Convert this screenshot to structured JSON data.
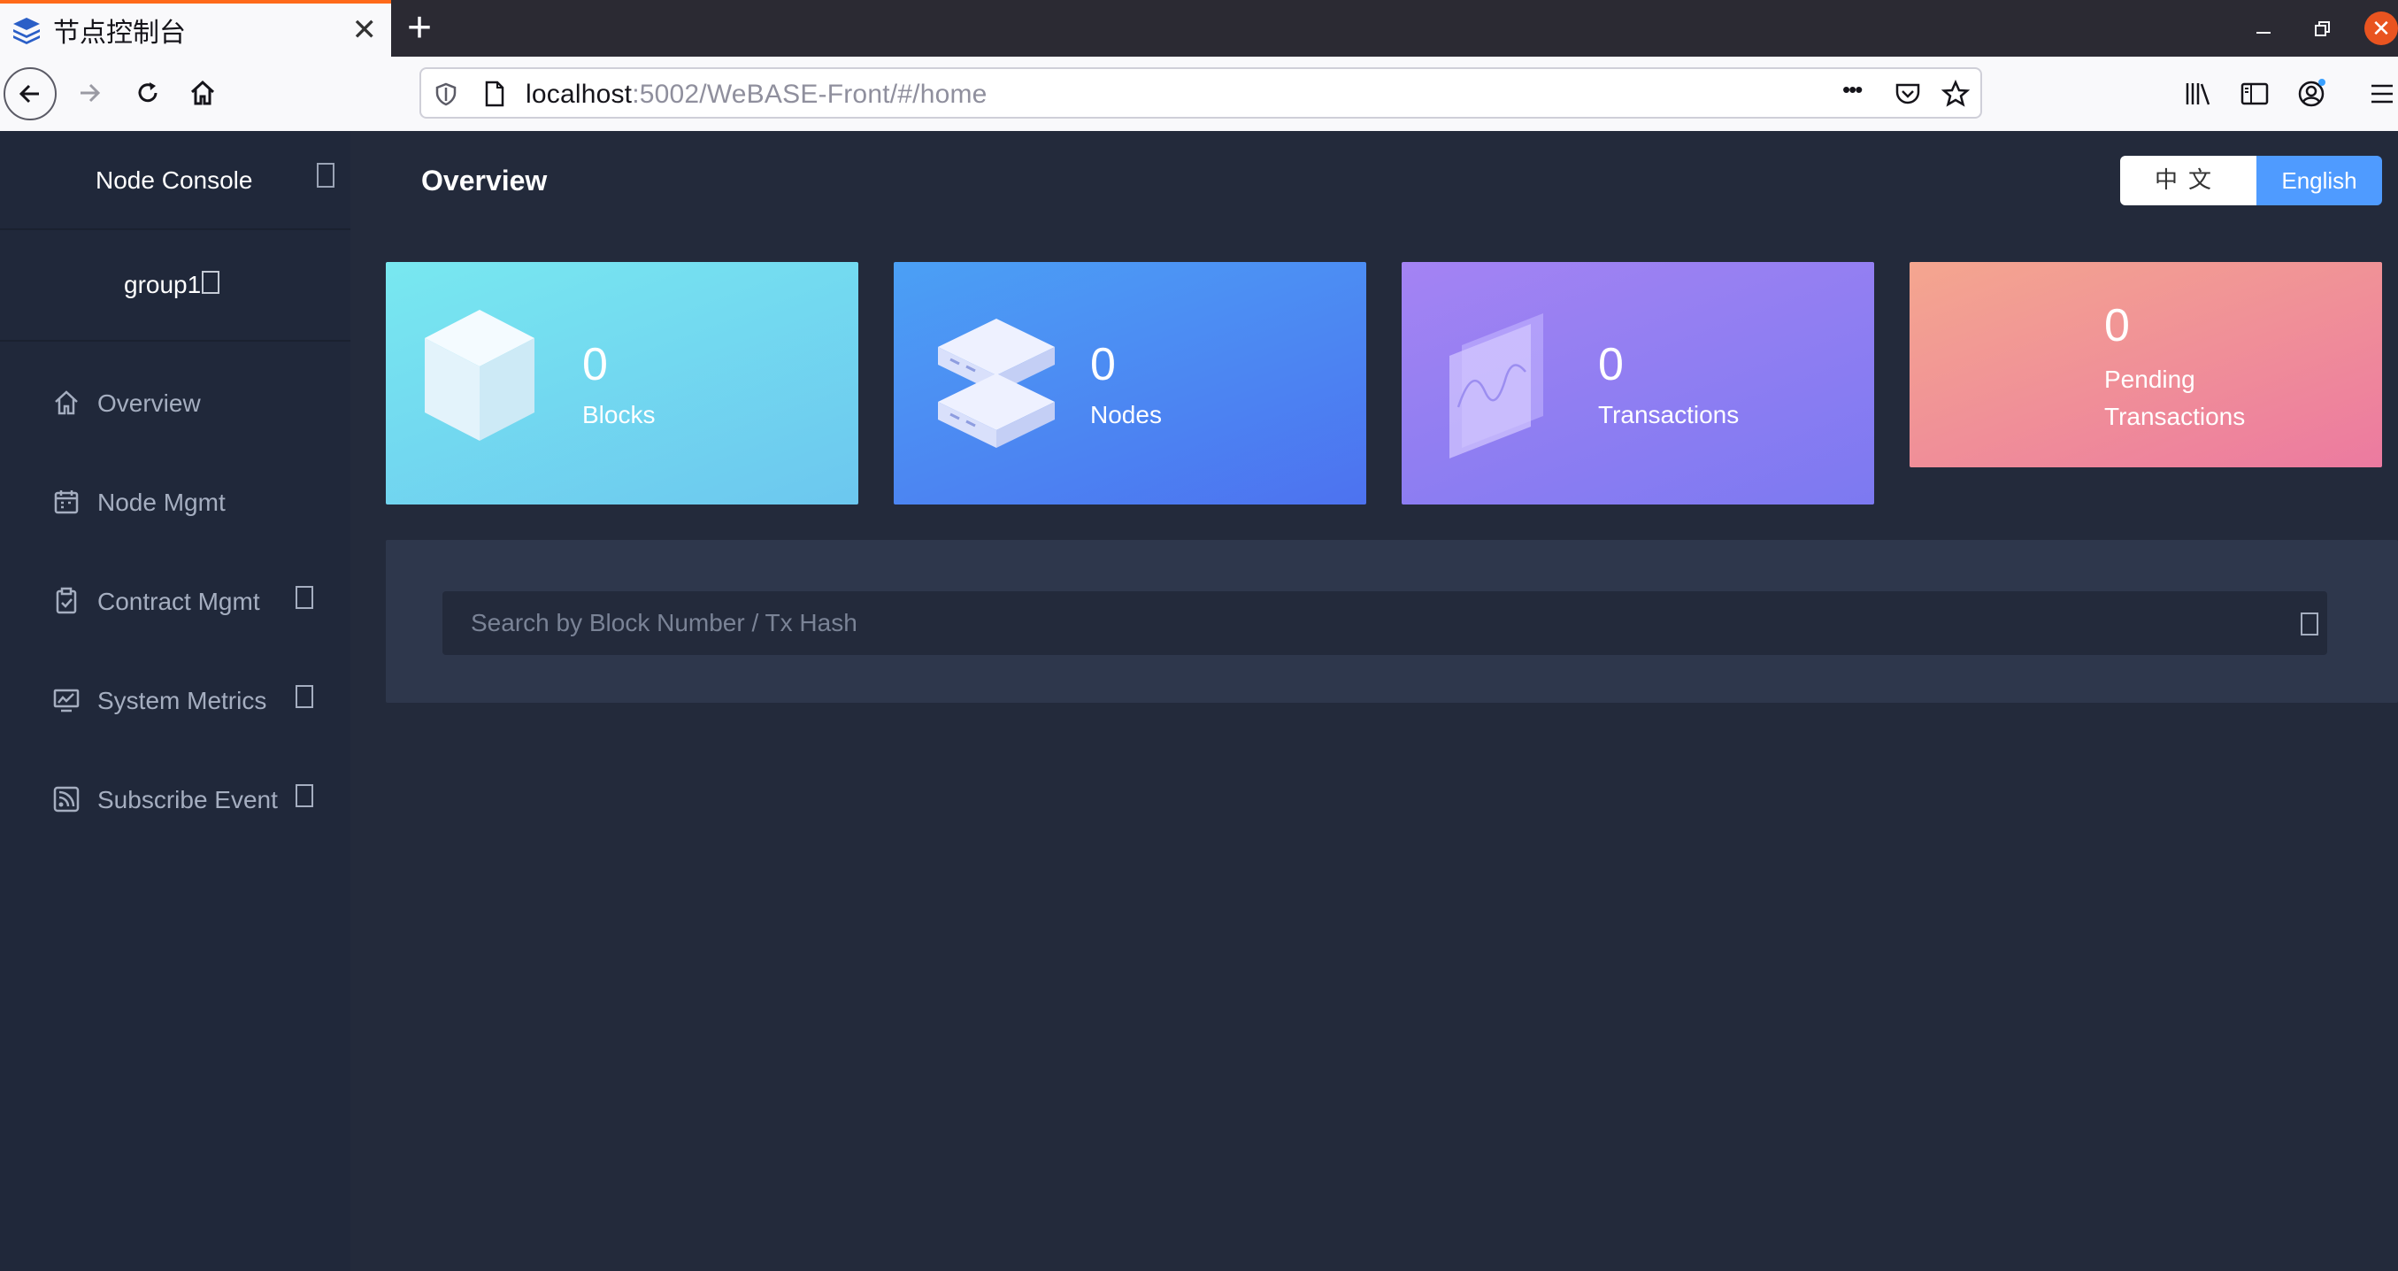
{
  "browser": {
    "tab_title": "节点控制台",
    "url_host": "localhost",
    "url_rest": ":5002/WeBASE-Front/#/home",
    "new_tab_symbol": "+",
    "close_symbol": "✕",
    "menu_dots": "•••"
  },
  "sidebar": {
    "title": "Node Console",
    "group": "group1",
    "items": [
      {
        "label": "Overview",
        "icon": "home-icon"
      },
      {
        "label": "Node Mgmt",
        "icon": "calendar-icon"
      },
      {
        "label": "Contract Mgmt",
        "icon": "clipboard-icon"
      },
      {
        "label": "System Metrics",
        "icon": "monitor-chart-icon"
      },
      {
        "label": "Subscribe Event",
        "icon": "rss-icon"
      }
    ]
  },
  "header": {
    "title": "Overview",
    "lang_zh": "中文",
    "lang_en": "English"
  },
  "cards": {
    "blocks": {
      "value": "0",
      "label": "Blocks"
    },
    "nodes": {
      "value": "0",
      "label": "Nodes"
    },
    "transactions": {
      "value": "0",
      "label": "Transactions"
    },
    "pending": {
      "value": "0",
      "label_line1": "Pending",
      "label_line2": "Transactions"
    }
  },
  "search": {
    "placeholder": "Search by Block Number / Tx Hash"
  },
  "colors": {
    "accent": "#4f9bff",
    "tab_indicator": "#ff6a1a",
    "sidebar_bg": "#20283a",
    "main_bg": "#232a3b"
  }
}
